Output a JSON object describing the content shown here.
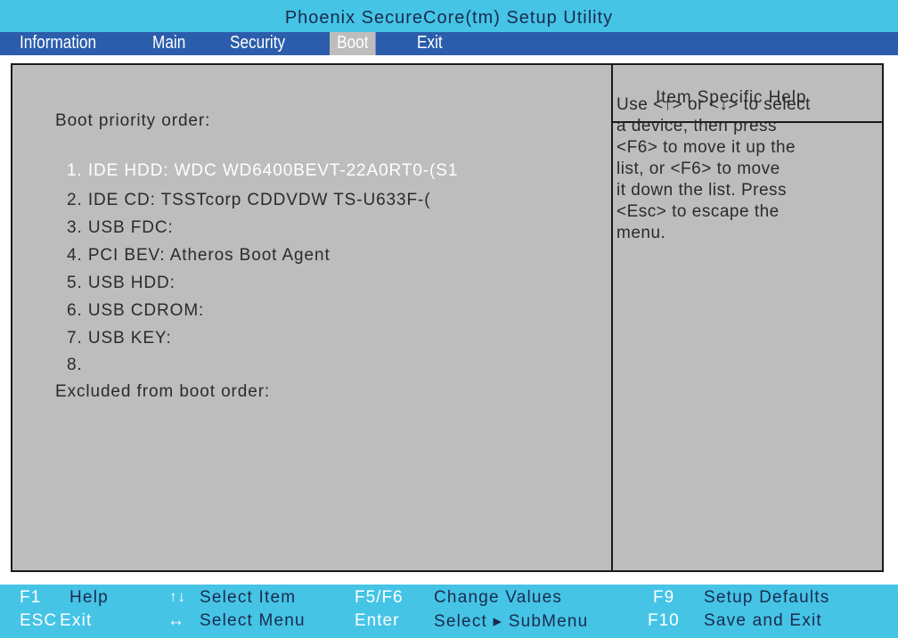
{
  "title": "Phoenix SecureCore(tm) Setup Utility",
  "menu": {
    "items": [
      {
        "label": "Information",
        "active": false
      },
      {
        "label": "Main",
        "active": false
      },
      {
        "label": "Security",
        "active": false
      },
      {
        "label": "Boot",
        "active": true
      },
      {
        "label": "Exit",
        "active": false
      }
    ]
  },
  "boot": {
    "priority_heading": "Boot priority order:",
    "items": [
      {
        "label": "1. IDE HDD: WDC WD6400BEVT-22A0RT0-(S1",
        "selected": true
      },
      {
        "label": "2. IDE CD: TSSTcorp CDDVDW TS-U633F-(",
        "selected": false
      },
      {
        "label": "3. USB FDC:",
        "selected": false
      },
      {
        "label": "4. PCI BEV: Atheros Boot Agent",
        "selected": false
      },
      {
        "label": "5. USB HDD:",
        "selected": false
      },
      {
        "label": "6. USB CDROM:",
        "selected": false
      },
      {
        "label": "7. USB KEY:",
        "selected": false
      },
      {
        "label": "8.",
        "selected": false
      }
    ],
    "excluded_heading": "Excluded from boot order:"
  },
  "help": {
    "title": "Item Specific Help",
    "lines": [
      "Use <↑> or <↓> to select",
      "a device, then press",
      "<F6> to move it up the",
      "list, or <F6> to move",
      "it down the list. Press",
      "<Esc> to escape the",
      "menu."
    ]
  },
  "footer": {
    "row1": {
      "key1": "F1",
      "desc1": "Help",
      "icon2": "↑↓",
      "desc2": "Select  Item",
      "key3": "F5/F6",
      "desc3": "Change  Values",
      "key4": "F9",
      "desc4": "Setup  Defaults"
    },
    "row2": {
      "key1": "ESC",
      "desc1": "Exit",
      "icon2": "↔",
      "desc2": "Select  Menu",
      "key3": "Enter",
      "desc3": "Select  ▸  SubMenu",
      "key4": "F10",
      "desc4": "Save  and  Exit"
    }
  },
  "colors": {
    "title_bg": "#45c4e6",
    "menu_bg": "#2b5dac",
    "panel_bg": "#bdbdbd",
    "selected_text": "#ffffff",
    "normal_text": "#2b2b2b"
  }
}
